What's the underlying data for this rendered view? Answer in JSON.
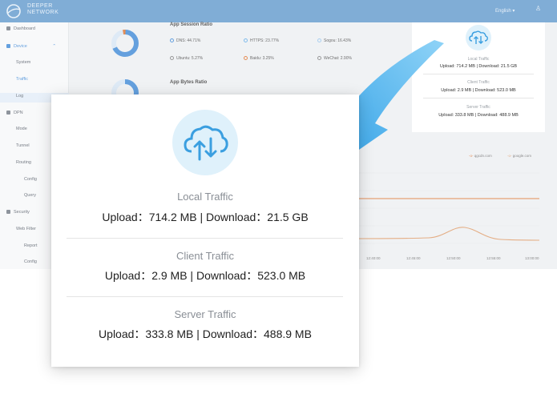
{
  "header": {
    "brand_line1": "DEEPER",
    "brand_line2": "NETWORK",
    "language": "English",
    "user_icon": "user-icon"
  },
  "sidebar": {
    "items": [
      {
        "label": "Dashboard",
        "icon": "home-icon"
      },
      {
        "label": "Device",
        "icon": "device-icon"
      },
      {
        "label": "System"
      },
      {
        "label": "Traffic"
      },
      {
        "label": "Log"
      },
      {
        "label": "DPN",
        "icon": "dpn-icon"
      },
      {
        "label": "Mode"
      },
      {
        "label": "Tunnel"
      },
      {
        "label": "Routing"
      },
      {
        "label": "Config"
      },
      {
        "label": "Query"
      },
      {
        "label": "Security",
        "icon": "lock-icon"
      },
      {
        "label": "Web Filter"
      },
      {
        "label": "Report"
      },
      {
        "label": "Config"
      }
    ]
  },
  "session_ratio": {
    "title": "App Session Ratio",
    "items": [
      {
        "label": "DNS: 44.71%",
        "color": "#4a90d9"
      },
      {
        "label": "HTTPS: 23.77%",
        "color": "#6ab0e8"
      },
      {
        "label": "Sogou: 16.43%",
        "color": "#9cc8ee"
      },
      {
        "label": "Ubuntu: 5.27%",
        "color": "#c5c9ce"
      },
      {
        "label": "Baidu: 3.25%",
        "color": "#e07b39"
      },
      {
        "label": "WeChat: 2.90%",
        "color": "#c5c9ce"
      }
    ]
  },
  "bytes_ratio": {
    "title": "App Bytes Ratio"
  },
  "traffic_chart": {
    "legend": [
      {
        "label": "qgcdn.com",
        "color": "#e07b39"
      },
      {
        "label": "google.com",
        "color": "#e0a070"
      }
    ],
    "x_ticks": [
      "12:40:00",
      "12:45:00",
      "12:50:00",
      "12:55:00",
      "13:00:00"
    ]
  },
  "small_card": {
    "local_label": "Local Traffic",
    "local_value": "Upload: 714.2 MB  |  Download: 21.5 GB",
    "client_label": "Client Traffic",
    "client_value": "Upload: 2.9 MB  |  Download: 523.0 MB",
    "server_label": "Server Traffic",
    "server_value": "Upload: 333.8 MB  |  Download: 488.9 MB"
  },
  "big_card": {
    "local_label": "Local Traffic",
    "local_value": "Upload：714.2 MB  |  Download：21.5 GB",
    "client_label": "Client Traffic",
    "client_value": "Upload：2.9 MB  |  Download：523.0 MB",
    "server_label": "Server Traffic",
    "server_value": "Upload：333.8 MB  |  Download：488.9 MB"
  },
  "colors": {
    "accent": "#4a90d9",
    "arrow": "#3fa9e8",
    "icon_bg": "#dff1fb",
    "icon_stroke": "#3b9fe0"
  }
}
